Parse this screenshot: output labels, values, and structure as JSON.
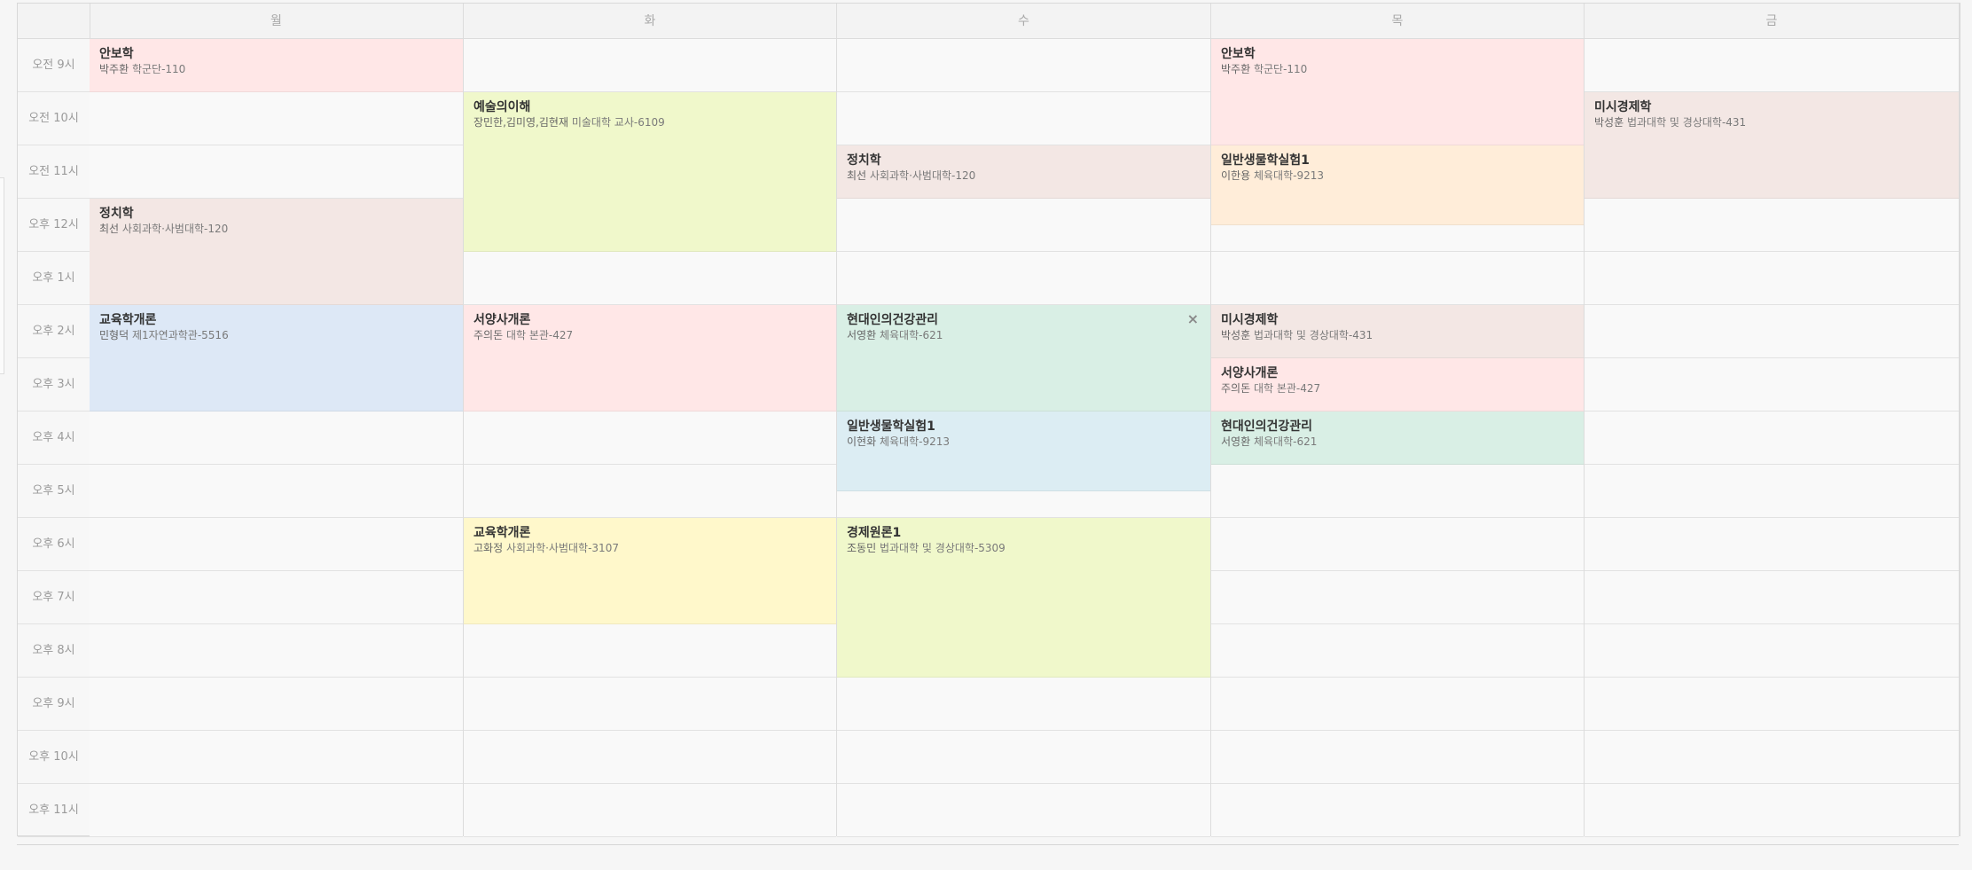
{
  "days": [
    "월",
    "화",
    "수",
    "목",
    "금"
  ],
  "times": [
    "오전 9시",
    "오전 10시",
    "오전 11시",
    "오후 12시",
    "오후 1시",
    "오후 2시",
    "오후 3시",
    "오후 4시",
    "오후 5시",
    "오후 6시",
    "오후 7시",
    "오후 8시",
    "오후 9시",
    "오후 10시",
    "오후 11시"
  ],
  "colors": {
    "pink": "#ffe7e7",
    "lime": "#f0f8cb",
    "taupe": "#f3e7e4",
    "blue": "#dde8f6",
    "mint": "#d9efe5",
    "skyblue": "#dcedf3",
    "peach": "#ffedd9",
    "yellow": "#fff8cb"
  },
  "courses": [
    {
      "day": 0,
      "start": 0,
      "end": 1,
      "title": "안보학",
      "prof": "박주환",
      "room": "학군단-110",
      "color": "pink"
    },
    {
      "day": 0,
      "start": 3,
      "end": 5,
      "title": "정치학",
      "prof": "최선",
      "room": "사회과학·사범대학-120",
      "color": "taupe"
    },
    {
      "day": 0,
      "start": 5,
      "end": 7,
      "title": "교육학개론",
      "prof": "민형덕",
      "room": "제1자연과학관-5516",
      "color": "blue"
    },
    {
      "day": 1,
      "start": 1,
      "end": 4,
      "title": "예술의이해",
      "prof": "장민한,김미영,김현재",
      "room": "미술대학 교사-6109",
      "color": "lime"
    },
    {
      "day": 1,
      "start": 5,
      "end": 7,
      "title": "서양사개론",
      "prof": "주의돈",
      "room": "대학 본관-427",
      "color": "pink"
    },
    {
      "day": 1,
      "start": 9,
      "end": 11,
      "title": "교육학개론",
      "prof": "고화정",
      "room": "사회과학·사범대학-3107",
      "color": "yellow"
    },
    {
      "day": 2,
      "start": 2,
      "end": 3,
      "title": "정치학",
      "prof": "최선",
      "room": "사회과학·사범대학-120",
      "color": "taupe"
    },
    {
      "day": 2,
      "start": 5,
      "end": 7,
      "title": "현대인의건강관리",
      "prof": "서영환",
      "room": "체육대학-621",
      "color": "mint",
      "closable": true
    },
    {
      "day": 2,
      "start": 7,
      "end": 8.5,
      "title": "일반생물학실험1",
      "prof": "이현화",
      "room": "체육대학-9213",
      "color": "skyblue"
    },
    {
      "day": 2,
      "start": 9,
      "end": 12,
      "title": "경제원론1",
      "prof": "조동민",
      "room": "법과대학 및 경상대학-5309",
      "color": "lime"
    },
    {
      "day": 3,
      "start": 0,
      "end": 2,
      "title": "안보학",
      "prof": "박주환",
      "room": "학군단-110",
      "color": "pink"
    },
    {
      "day": 3,
      "start": 2,
      "end": 3.5,
      "title": "일반생물학실험1",
      "prof": "이한용",
      "room": "체육대학-9213",
      "color": "peach"
    },
    {
      "day": 3,
      "start": 5,
      "end": 6,
      "title": "미시경제학",
      "prof": "박성훈",
      "room": "법과대학 및 경상대학-431",
      "color": "taupe"
    },
    {
      "day": 3,
      "start": 6,
      "end": 7,
      "title": "서양사개론",
      "prof": "주의돈",
      "room": "대학 본관-427",
      "color": "pink"
    },
    {
      "day": 3,
      "start": 7,
      "end": 8,
      "title": "현대인의건강관리",
      "prof": "서영환",
      "room": "체육대학-621",
      "color": "mint"
    },
    {
      "day": 4,
      "start": 1,
      "end": 3,
      "title": "미시경제학",
      "prof": "박성훈",
      "room": "법과대학 및 경상대학-431",
      "color": "taupe"
    }
  ],
  "close_symbol": "×"
}
